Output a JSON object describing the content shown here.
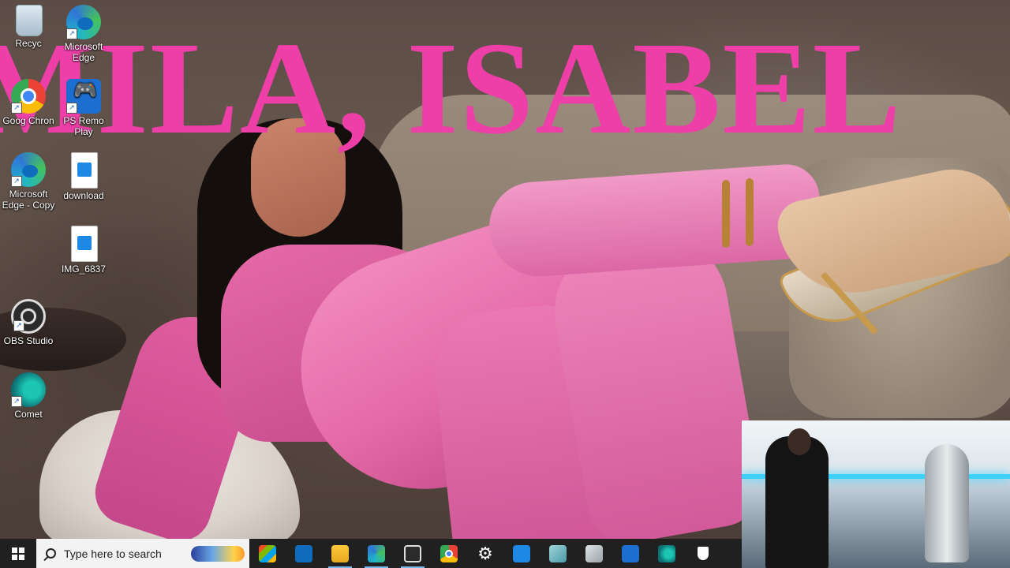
{
  "wallpaper": {
    "overlay_text": "MILA, ISABEL"
  },
  "desktop_icons": [
    {
      "label": "Recyc",
      "icon": "recycle-bin-icon"
    },
    {
      "label": "Microsoft Edge",
      "icon": "edge-icon"
    },
    {
      "label": "Goog Chron",
      "icon": "chrome-icon"
    },
    {
      "label": "PS Remo Play",
      "icon": "ps-remote-play-icon"
    },
    {
      "label": "Microsoft Edge - Copy",
      "icon": "edge-icon"
    },
    {
      "label": "download",
      "icon": "image-file-icon"
    },
    {
      "label": "IMG_6837",
      "icon": "video-file-icon"
    },
    {
      "label": "OBS Studio",
      "icon": "obs-icon"
    },
    {
      "label": "Comet",
      "icon": "comet-icon"
    }
  ],
  "taskbar": {
    "search_placeholder": "Type here to search",
    "apps": [
      {
        "name": "Microsoft Store",
        "icon": "store-icon"
      },
      {
        "name": "Mail",
        "icon": "mail-icon"
      },
      {
        "name": "File Explorer",
        "icon": "folder-icon"
      },
      {
        "name": "Microsoft Edge",
        "icon": "edge-icon"
      },
      {
        "name": "OBS Studio",
        "icon": "obs-icon"
      },
      {
        "name": "Google Chrome",
        "icon": "chrome-icon"
      },
      {
        "name": "Settings",
        "icon": "gear-icon"
      },
      {
        "name": "Video",
        "icon": "video-icon"
      },
      {
        "name": "App",
        "icon": "app-icon"
      },
      {
        "name": "App",
        "icon": "app-icon"
      },
      {
        "name": "PS Remote Play",
        "icon": "ps-remote-play-icon"
      },
      {
        "name": "Comet",
        "icon": "comet-icon"
      },
      {
        "name": "Windows Security",
        "icon": "shield-icon"
      }
    ]
  }
}
